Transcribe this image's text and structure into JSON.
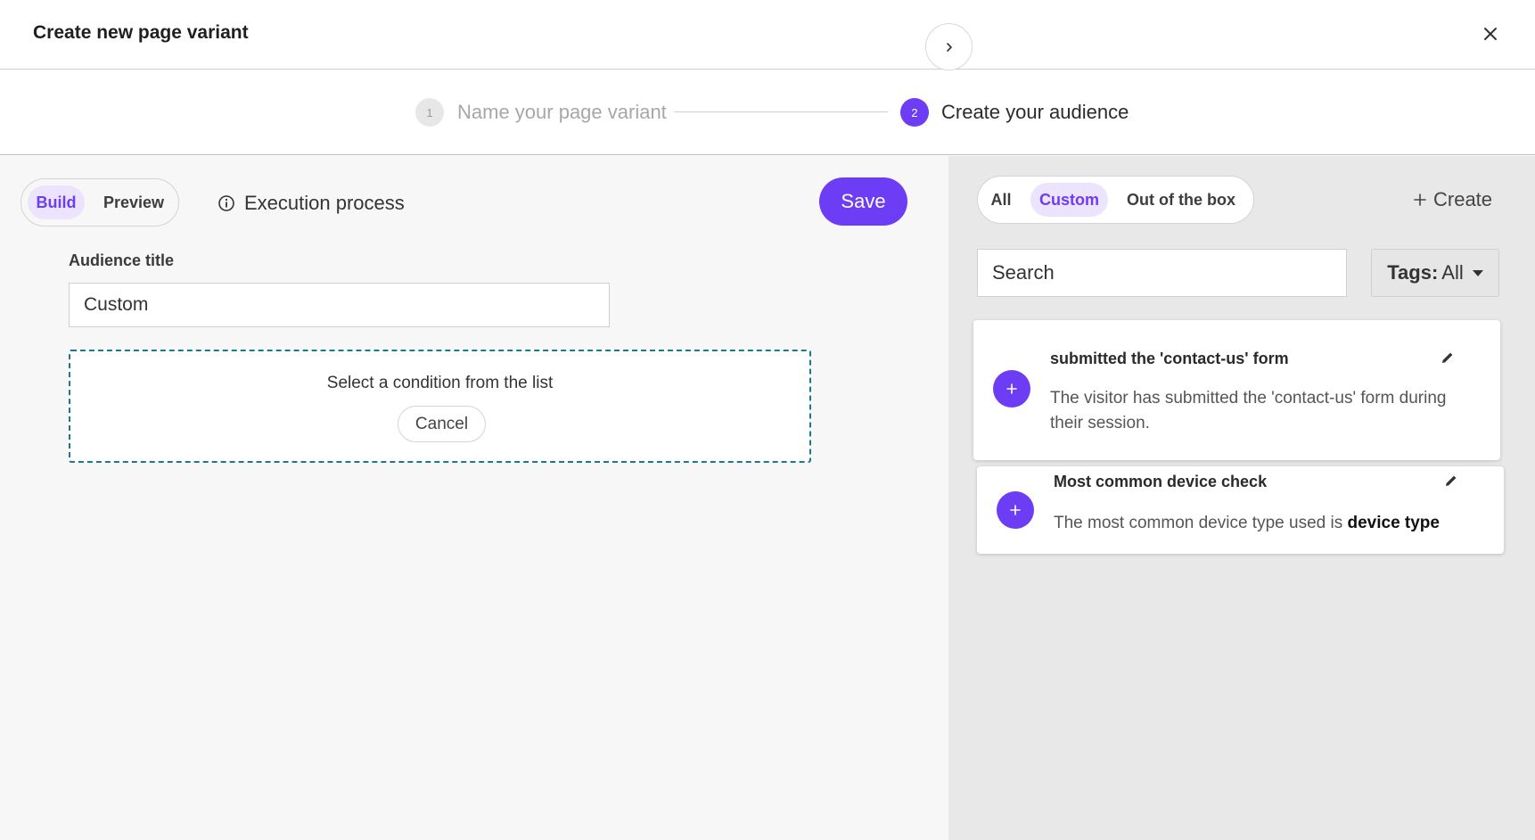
{
  "dialog": {
    "title": "Create new page variant",
    "close_icon": "close-icon"
  },
  "stepper": {
    "steps": [
      {
        "number": "1",
        "label": "Name your page variant",
        "state": "inactive"
      },
      {
        "number": "2",
        "label": "Create your audience",
        "state": "active"
      }
    ]
  },
  "builder": {
    "mode_toggle": {
      "build": "Build",
      "preview": "Preview",
      "selected": "Build"
    },
    "execution_process": "Execution process",
    "save_label": "Save",
    "audience_title_label": "Audience title",
    "audience_title_value": "Custom",
    "condition_prompt": "Select a condition from the list",
    "cancel_label": "Cancel"
  },
  "library": {
    "filters": {
      "all": "All",
      "custom": "Custom",
      "out_of_box": "Out of the box",
      "selected": "Custom"
    },
    "create_label": "Create",
    "search_placeholder": "Search",
    "tags_label": "Tags:",
    "tags_value": "All",
    "conditions": [
      {
        "title": "submitted the 'contact-us' form",
        "description": "The visitor has submitted the 'contact-us' form during their session."
      },
      {
        "title": "Most common device check",
        "description_prefix": "The most common device type used is",
        "description_bold": "device type"
      }
    ]
  },
  "colors": {
    "accent": "#6d3cf5",
    "accent_light": "#ece4ff",
    "dashed_border": "#197a8c"
  }
}
